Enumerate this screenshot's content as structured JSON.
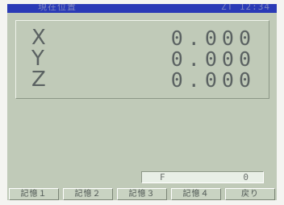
{
  "header": {
    "title": "現在位置",
    "info": "ZT 12:34"
  },
  "coordinates": [
    {
      "axis": "X",
      "value": "0.000"
    },
    {
      "axis": "Y",
      "value": "0.000"
    },
    {
      "axis": "Z",
      "value": "0.000"
    }
  ],
  "feed": {
    "label": "F",
    "value": "0"
  },
  "softkeys": [
    {
      "label": "記憶１"
    },
    {
      "label": "記憶２"
    },
    {
      "label": "記憶３"
    },
    {
      "label": "記憶４"
    },
    {
      "label": "戻り"
    }
  ]
}
